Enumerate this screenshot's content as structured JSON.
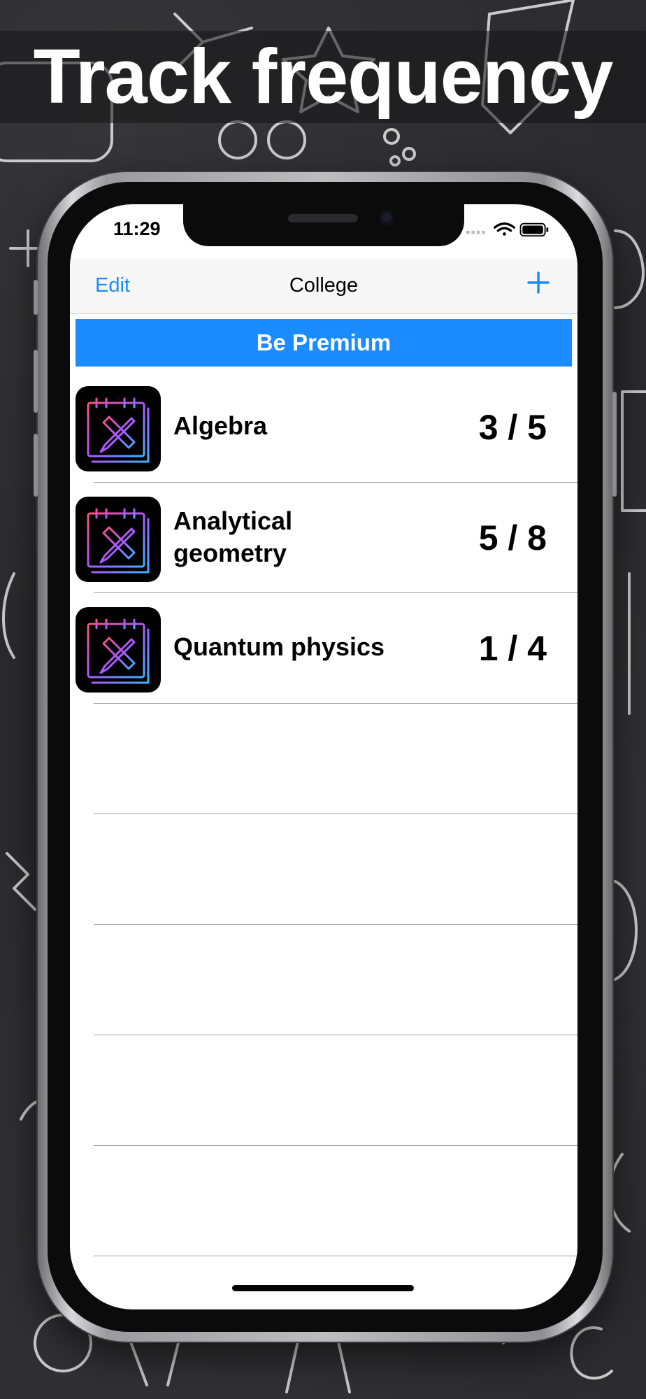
{
  "headline": "Track frequency",
  "status": {
    "time": "11:29"
  },
  "nav": {
    "edit": "Edit",
    "title": "College",
    "add_icon": "plus-icon"
  },
  "premium": "Be  Premium",
  "items": [
    {
      "name": "Algebra",
      "count": "3 / 5",
      "icon": "notebook-pencil-ruler-icon"
    },
    {
      "name": "Analytical\ngeometry",
      "count": "5 / 8",
      "icon": "notebook-pencil-ruler-icon"
    },
    {
      "name": "Quantum physics",
      "count": "1 / 4",
      "icon": "notebook-pencil-ruler-icon"
    }
  ],
  "colors": {
    "accent": "#1a8cff",
    "background": "#2b2b2d"
  }
}
